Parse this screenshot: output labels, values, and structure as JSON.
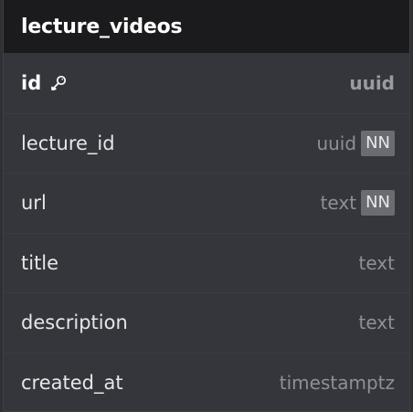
{
  "table": {
    "name": "lecture_videos",
    "columns": [
      {
        "name": "id",
        "type": "uuid",
        "primary_key": true,
        "key_icon": "key-icon",
        "not_null": false
      },
      {
        "name": "lecture_id",
        "type": "uuid",
        "primary_key": false,
        "not_null": true,
        "badge": "NN"
      },
      {
        "name": "url",
        "type": "text",
        "primary_key": false,
        "not_null": true,
        "badge": "NN"
      },
      {
        "name": "title",
        "type": "text",
        "primary_key": false,
        "not_null": false
      },
      {
        "name": "description",
        "type": "text",
        "primary_key": false,
        "not_null": false
      },
      {
        "name": "created_at",
        "type": "timestamptz",
        "primary_key": false,
        "not_null": false
      }
    ]
  },
  "colors": {
    "header_bg": "#1b1b1d",
    "body_bg": "#35363c",
    "badge_bg": "#6b6c72"
  }
}
